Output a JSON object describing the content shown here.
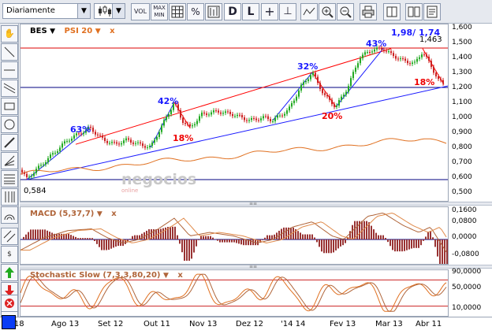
{
  "toolbar": {
    "period_select": "Diariamente",
    "chart_type_icon": "candlestick-icon",
    "volume_label": "VOL",
    "minmax_label_top": "MAX",
    "minmax_label_bottom": "MIN",
    "percent_label": "%",
    "daily_label": "D",
    "log_label": "L"
  },
  "legend": {
    "symbol": "BES",
    "symbol_arrow": "▼",
    "indicator": "PSI 20",
    "indicator_arrow": "▼",
    "indicator_close": "x",
    "macd": "MACD (5,37,7)",
    "macd_arrow": "▼",
    "macd_close": "x",
    "stoch": "Stochastic Slow (7,3,3,80,20)",
    "stoch_arrow": "▼",
    "stoch_close": "x"
  },
  "annotations": {
    "pct1": "63%",
    "pct2": "42%",
    "pct3": "18%",
    "pct4": "32%",
    "pct5": "20%",
    "pct6": "43%",
    "pct7": "18%",
    "targets": "1,98/ 1,74",
    "high": "1,463",
    "low": "0,584"
  },
  "watermark": {
    "text": "negocios",
    "sub": "online"
  },
  "price_axis": [
    "1,600",
    "1,500",
    "1,400",
    "1,300",
    "1,200",
    "1,100",
    "1,000",
    "0,900",
    "0,800",
    "0,700",
    "0,600",
    "0,500"
  ],
  "macd_axis": [
    "0,1600",
    "0,0800",
    "0,0000",
    "-0,0800"
  ],
  "stoch_axis": [
    "90,0000",
    "50,0000",
    "10,0000"
  ],
  "x_axis": [
    "13 18",
    "Ago 13",
    "Set 12",
    "Out 11",
    "Nov 13",
    "Dez 12",
    "'14 14",
    "Fev 13",
    "Mar 13",
    "Abr 11"
  ],
  "colors": {
    "candle_up": "#22aa22",
    "candle_down": "#cc2222",
    "channel_upper": "#ff0000",
    "channel_lower": "#1a1aff",
    "psi": "#e07020",
    "macd_line": "#b0653a",
    "hist_pos": "#993333",
    "annotation_blue": "#1a1aff",
    "annotation_red": "#ee0000"
  },
  "chart_data": [
    {
      "type": "line",
      "title": "",
      "xlabel": "",
      "ylabel": "",
      "ylim": [
        0.5,
        1.6
      ],
      "series": [
        {
          "name": "BES",
          "x": [
            "13 18",
            "Ago 13",
            "Set 12",
            "Out 11",
            "Nov 13",
            "Dez 12",
            "'14 14",
            "Fev 13",
            "Mar 13",
            "Abr 11"
          ],
          "values": [
            0.6,
            0.82,
            0.8,
            0.8,
            1.0,
            1.0,
            1.1,
            1.1,
            1.4,
            1.2
          ]
        },
        {
          "name": "PSI 20",
          "x": [
            "13 18",
            "Ago 13",
            "Set 12",
            "Out 11",
            "Nov 13",
            "Dez 12",
            "'14 14",
            "Fev 13",
            "Mar 13",
            "Abr 11"
          ],
          "values": [
            0.62,
            0.66,
            0.7,
            0.72,
            0.76,
            0.8,
            0.82,
            0.84,
            0.88,
            0.86
          ]
        }
      ]
    },
    {
      "type": "line",
      "title": "",
      "ylim": [
        -0.12,
        0.2
      ],
      "series": [
        {
          "name": "MACD (5,37,7)",
          "values": [
            0.0,
            0.05,
            0.03,
            0.08,
            0.1,
            0.02,
            0.09,
            0.06,
            0.15,
            -0.05
          ]
        }
      ]
    },
    {
      "type": "line",
      "title": "",
      "ylim": [
        0,
        100
      ],
      "series": [
        {
          "name": "Stochastic Slow (7,3,3,80,20)",
          "values": [
            30,
            80,
            40,
            75,
            85,
            45,
            80,
            20,
            90,
            15
          ]
        }
      ]
    }
  ]
}
